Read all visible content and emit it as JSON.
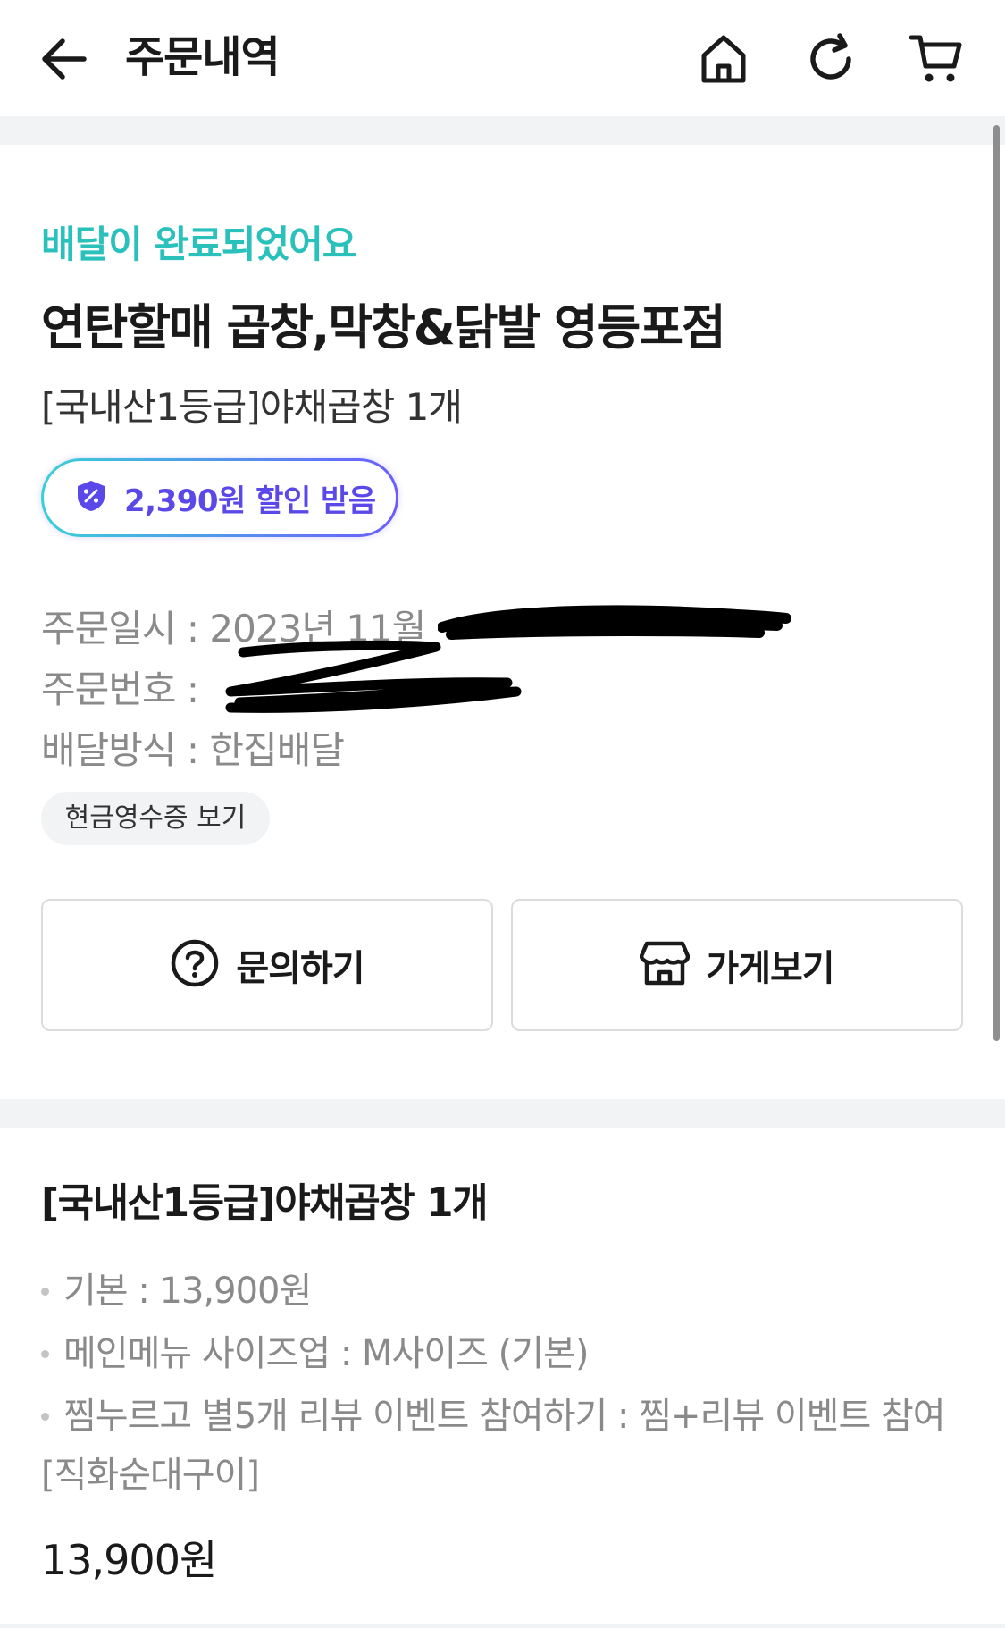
{
  "header": {
    "title": "주문내역",
    "icons": [
      "back-arrow-icon",
      "home-icon",
      "refresh-icon",
      "cart-icon"
    ]
  },
  "order": {
    "status": "배달이 완료되었어요",
    "store_name": "연탄할매 곱창,막창&닭발 영등포점",
    "menu_summary": "[국내산1등급]야채곱창 1개",
    "discount": "2,390원 할인 받음",
    "order_date_label": "주문일시 : ",
    "order_date_value": "2023년 11월",
    "order_number_label": "주문번호 : ",
    "delivery_method": "배달방식 : 한집배달",
    "receipt_button": "현금영수증 보기",
    "inquiry_button": "문의하기",
    "store_button": "가게보기"
  },
  "item": {
    "title": "[국내산1등급]야채곱창 1개",
    "options": [
      "기본 : 13,900원",
      "메인메뉴 사이즈업 : M사이즈 (기본)",
      "찜누르고 별5개 리뷰 이벤트 참여하기 : 찜+리뷰 이벤트 참여"
    ],
    "option_continuation": "[직화순대구이]",
    "price": "13,900원"
  },
  "colors": {
    "accent_mint": "#2ac1bc",
    "discount_purple": "#5a49e8",
    "muted_text": "#8a8a8a"
  }
}
